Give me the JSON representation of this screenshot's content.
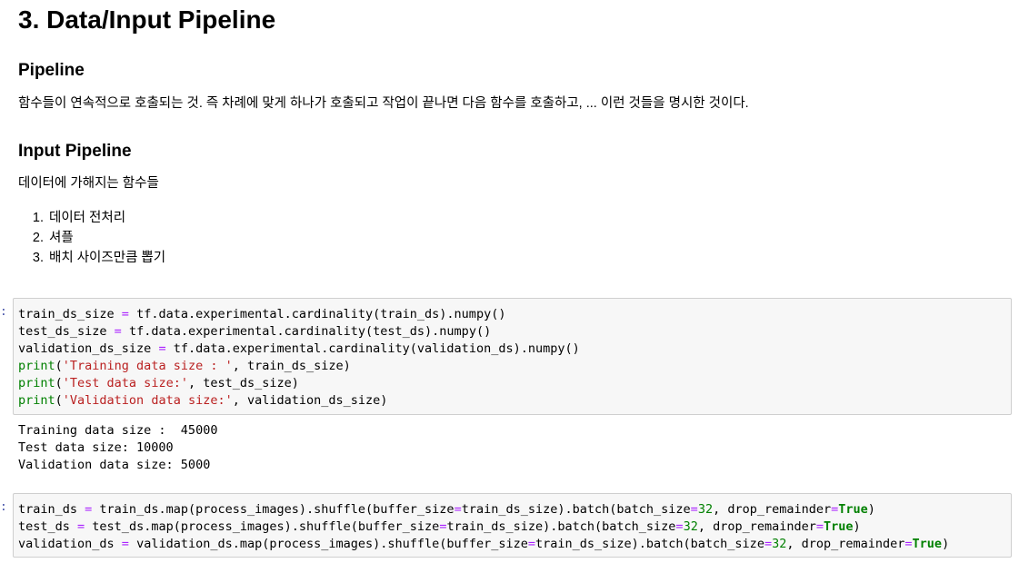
{
  "heading": "3. Data/Input Pipeline",
  "section_pipeline": {
    "title": "Pipeline",
    "description": "함수들이 연속적으로 호출되는 것. 즉 차례에 맞게 하나가 호출되고 작업이 끝나면 다음 함수를 호출하고, ... 이런 것들을 명시한 것이다."
  },
  "section_input_pipeline": {
    "title": "Input Pipeline",
    "description": "데이터에 가해지는 함수들",
    "steps": [
      "데이터 전처리",
      "셔플",
      "배치 사이즈만큼 뽑기"
    ]
  },
  "cell1": {
    "prompt": ":",
    "lines": {
      "l1": {
        "a": "train_ds_size ",
        "op": "=",
        "b": " tf.data.experimental.cardinality(train_ds).numpy()"
      },
      "l2": {
        "a": "test_ds_size ",
        "op": "=",
        "b": " tf.data.experimental.cardinality(test_ds).numpy()"
      },
      "l3": {
        "a": "validation_ds_size ",
        "op": "=",
        "b": " tf.data.experimental.cardinality(validation_ds).numpy()"
      },
      "l4": {
        "fn": "print",
        "open": "(",
        "str": "'Training data size : '",
        "rest": ", train_ds_size)"
      },
      "l5": {
        "fn": "print",
        "open": "(",
        "str": "'Test data size:'",
        "rest": ", test_ds_size)"
      },
      "l6": {
        "fn": "print",
        "open": "(",
        "str": "'Validation data size:'",
        "rest": ", validation_ds_size)"
      }
    }
  },
  "output1": {
    "lines": [
      "Training data size :  45000",
      "Test data size: 10000",
      "Validation data size: 5000"
    ]
  },
  "cell2": {
    "prompt": ":",
    "lines": {
      "l1": {
        "a": "train_ds ",
        "op1": "=",
        "b": " train_ds.map(process_images).shuffle(buffer_size",
        "op2": "=",
        "c": "train_ds_size).batch(batch_size",
        "op3": "=",
        "num": "32",
        "d": ", drop_remainder",
        "op4": "=",
        "kw": "True",
        "e": ")"
      },
      "l2": {
        "a": "test_ds ",
        "op1": "=",
        "b": " test_ds.map(process_images).shuffle(buffer_size",
        "op2": "=",
        "c": "train_ds_size).batch(batch_size",
        "op3": "=",
        "num": "32",
        "d": ", drop_remainder",
        "op4": "=",
        "kw": "True",
        "e": ")"
      },
      "l3": {
        "a": "validation_ds ",
        "op1": "=",
        "b": " validation_ds.map(process_images).shuffle(buffer_size",
        "op2": "=",
        "c": "train_ds_size).batch(batch_size",
        "op3": "=",
        "num": "32",
        "d": ", drop_remainder",
        "op4": "=",
        "kw": "True",
        "e": ")"
      }
    }
  }
}
